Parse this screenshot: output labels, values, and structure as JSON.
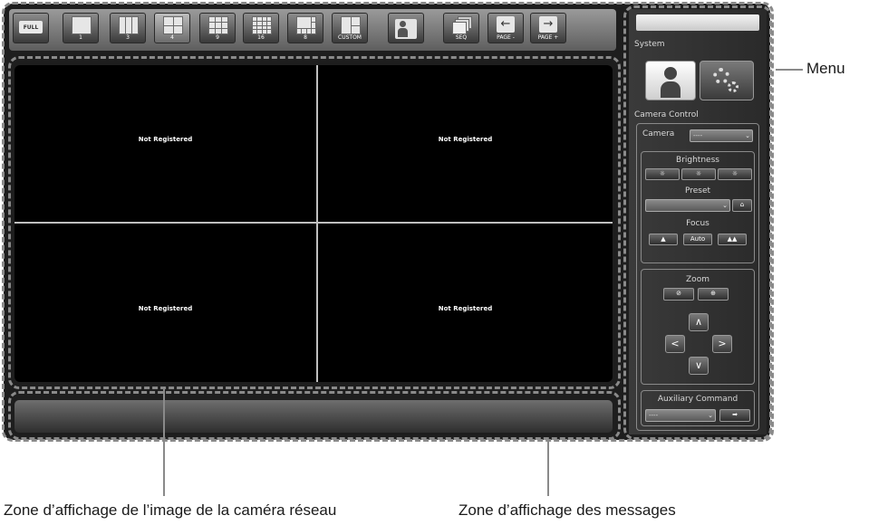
{
  "toolbar": {
    "buttons": [
      {
        "id": "full",
        "label": "FULL"
      },
      {
        "id": "layout-1",
        "label": "1"
      },
      {
        "id": "layout-3",
        "label": "3"
      },
      {
        "id": "layout-4",
        "label": "4"
      },
      {
        "id": "layout-9",
        "label": "9"
      },
      {
        "id": "layout-16",
        "label": "16"
      },
      {
        "id": "layout-8",
        "label": "8"
      },
      {
        "id": "custom",
        "label": "CUSTOM"
      },
      {
        "id": "person",
        "label": ""
      },
      {
        "id": "seq",
        "label": "SEQ"
      },
      {
        "id": "page-prev",
        "label": "PAGE -"
      },
      {
        "id": "page-next",
        "label": "PAGE +"
      }
    ]
  },
  "cameras": {
    "cells": [
      {
        "status": "Not Registered"
      },
      {
        "status": "Not Registered"
      },
      {
        "status": "Not Registered"
      },
      {
        "status": "Not Registered"
      }
    ]
  },
  "menu": {
    "system_label": "System",
    "camera_control_label": "Camera Control",
    "camera_label": "Camera",
    "camera_value": "----",
    "brightness_label": "Brightness",
    "preset_label": "Preset",
    "focus_label": "Focus",
    "focus_auto": "Auto",
    "zoom_label": "Zoom",
    "aux_label": "Auxiliary Command",
    "aux_value": "----"
  },
  "annotations": {
    "menu": "Menu",
    "camera_area": "Zone d’affichage de l’image de la caméra réseau",
    "message_area": "Zone d’affichage des messages"
  },
  "colors": {
    "annotation_dash": "#8a8a8a",
    "panel_bg": "#1e1e1e",
    "camera_bg": "#000000"
  }
}
